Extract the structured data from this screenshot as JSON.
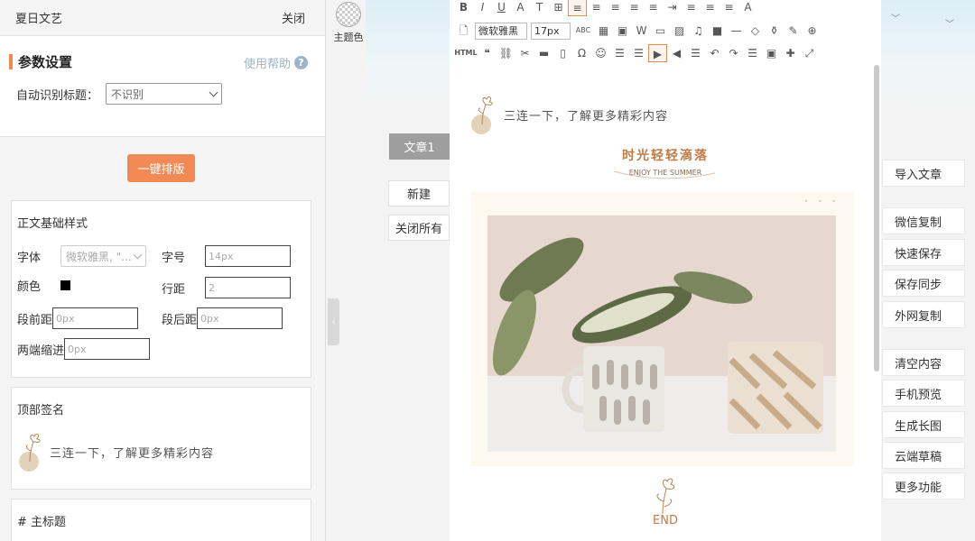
{
  "left_panel": {
    "app_title": "夏日文艺",
    "close_label": "关闭",
    "section_title": "参数设置",
    "help_label": "使用帮助",
    "help_icon": "question-icon",
    "auto_title_label": "自动识别标题：",
    "auto_title_value": "不识别",
    "format_button": "一键排版",
    "body_style": {
      "title": "正文基础样式",
      "font_label": "字体",
      "font_value": "微软雅黑, \"...",
      "size_label": "字号",
      "size_value": "14px",
      "color_label": "颜色",
      "color_value": "#000000",
      "line_height_label": "行距",
      "line_height_value": "2",
      "space_before_label": "段前距",
      "space_before_value": "0px",
      "space_after_label": "段后距",
      "space_after_value": "0px",
      "indent_label": "两端缩进",
      "indent_value": "0px"
    },
    "top_signature": {
      "title": "顶部签名",
      "text": "三连一下，了解更多精彩内容"
    },
    "main_heading": {
      "title": "# 主标题"
    }
  },
  "middle": {
    "theme_label": "主题色",
    "article_tab": "文章1",
    "new_button": "新建",
    "close_all_button": "关闭所有"
  },
  "toolbar": {
    "font_family": "微软雅黑",
    "font_size": "17px",
    "row1": [
      "B",
      "I",
      "U",
      "A",
      "T",
      "⊞",
      "≡",
      "≡",
      "≡",
      "≡",
      "≡",
      "⇥",
      "≡",
      "≡",
      "≡",
      "A"
    ],
    "row2": [
      "🗋",
      "ABC",
      "▦",
      "▣",
      "W",
      "▭",
      "▨",
      "♫",
      "■",
      "—",
      "◇",
      "⚱",
      "✎",
      "⊕"
    ],
    "row3": [
      "HTML",
      "❝",
      "⛓",
      "✂",
      "▬",
      "▯",
      "Ω",
      "☺",
      "☰",
      "☰",
      "▶",
      "◀",
      "☰",
      "↶",
      "↷",
      "☰",
      "▣",
      "✚",
      "⤢"
    ]
  },
  "editor": {
    "signature": "三连一下，了解更多精彩内容",
    "heading": "时光轻轻滴落",
    "subheading": "ENJOY THE SUMMER",
    "end_label": "END"
  },
  "right_actions": [
    "导入文章",
    "微信复制",
    "快速保存",
    "保存同步",
    "外网复制",
    "清空内容",
    "手机预览",
    "生成长图",
    "云端草稿",
    "更多功能"
  ],
  "colors": {
    "accent": "#f18a54",
    "heading": "#c27b45",
    "help": "#9fb3c8"
  }
}
